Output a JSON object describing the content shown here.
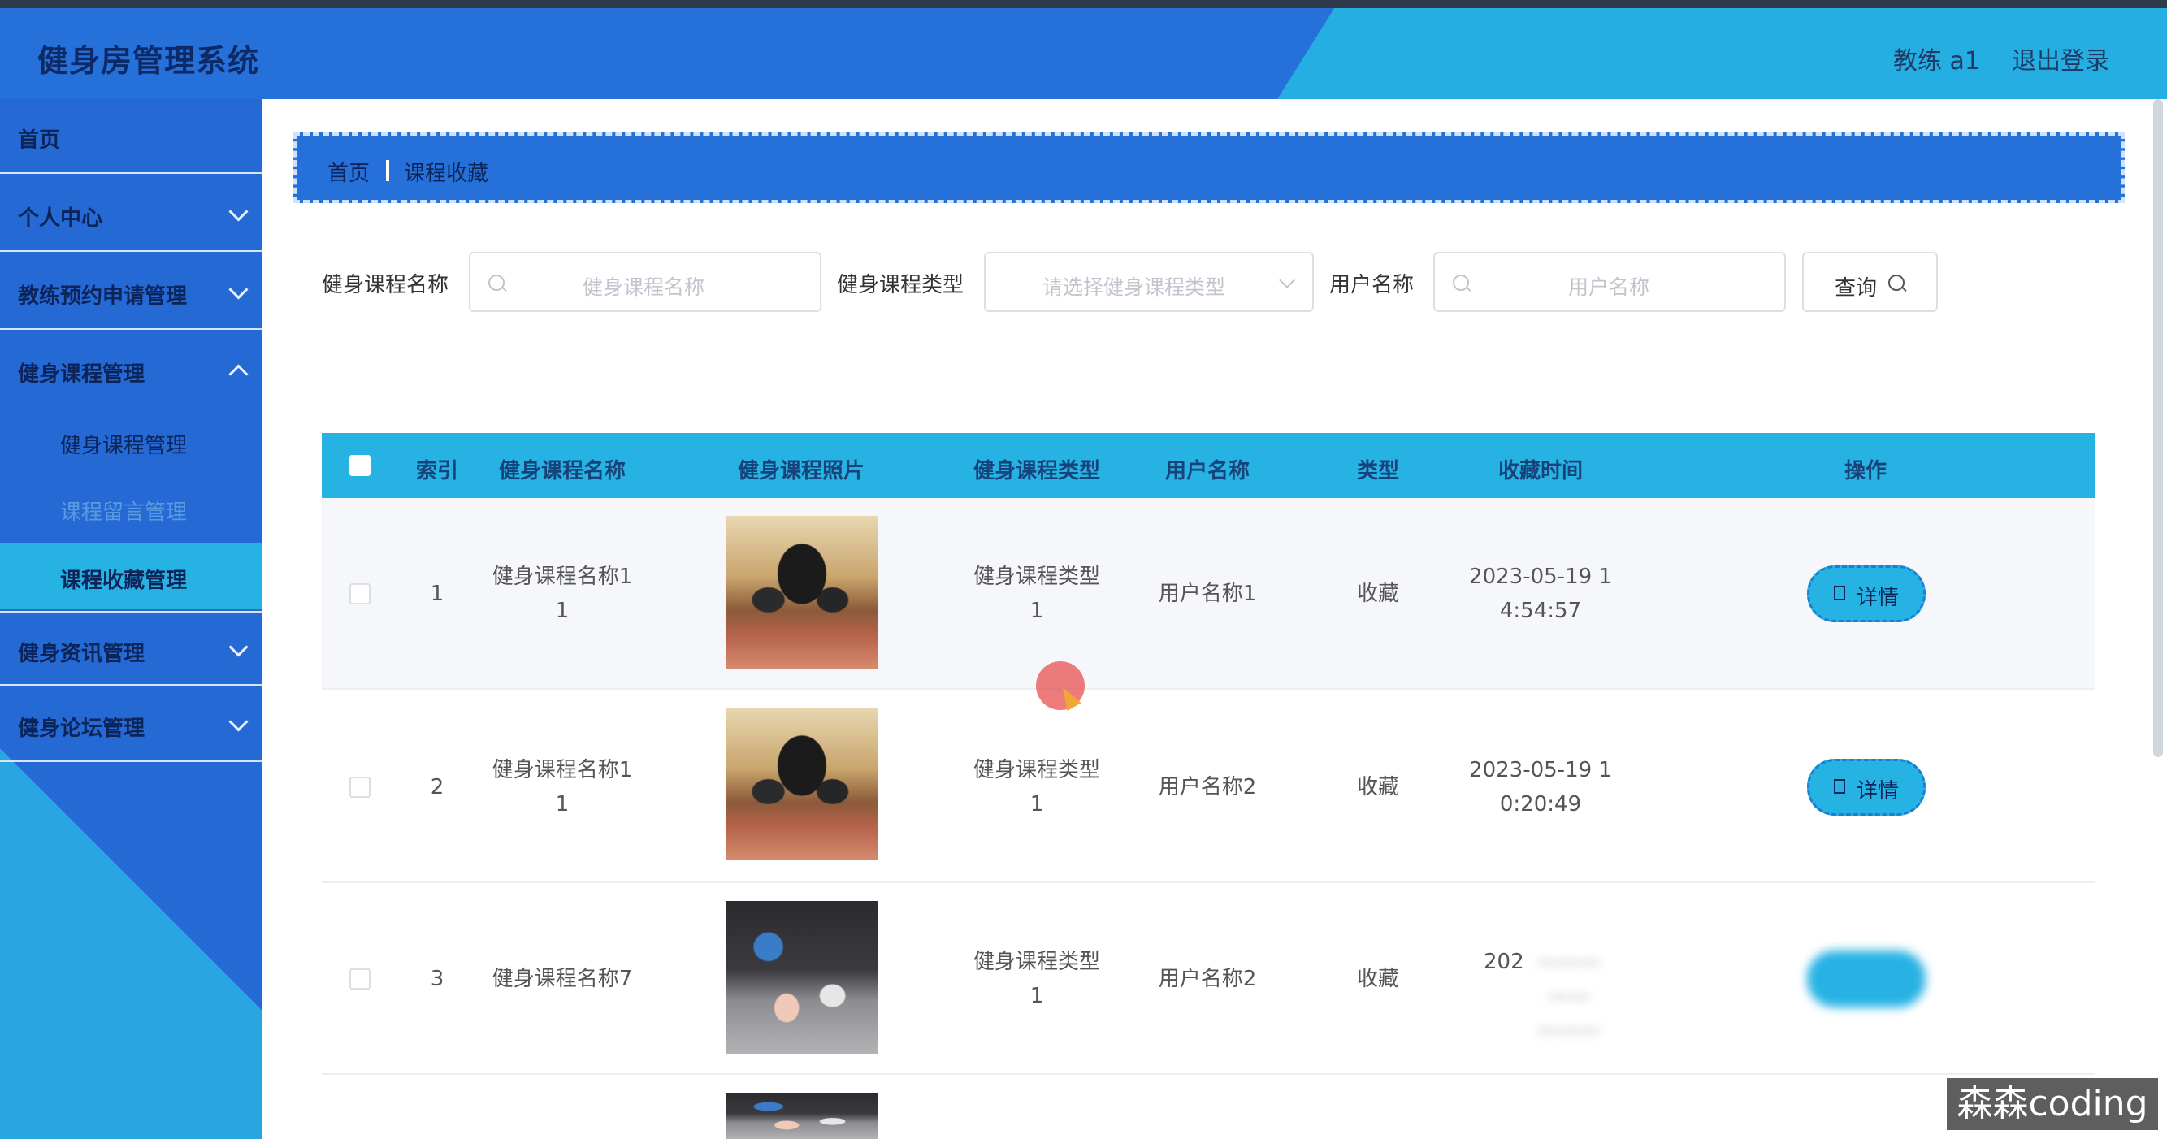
{
  "header": {
    "app_title": "健身房管理系统",
    "user_label": "教练 a1",
    "logout_label": "退出登录"
  },
  "sidebar": {
    "items": [
      {
        "label": "首页"
      },
      {
        "label": "个人中心"
      },
      {
        "label": "教练预约申请管理"
      },
      {
        "label": "健身课程管理"
      },
      {
        "label": "健身资讯管理"
      },
      {
        "label": "健身论坛管理"
      }
    ],
    "sub_items": [
      {
        "label": "健身课程管理"
      },
      {
        "label": "课程留言管理"
      },
      {
        "label": "课程收藏管理"
      }
    ]
  },
  "breadcrumb": {
    "home": "首页",
    "current": "课程收藏"
  },
  "filters": {
    "course_name_label": "健身课程名称",
    "course_name_placeholder": "健身课程名称",
    "course_type_label": "健身课程类型",
    "course_type_placeholder": "请选择健身课程类型",
    "user_name_label": "用户名称",
    "user_name_placeholder": "用户名称",
    "query_label": "查询"
  },
  "table": {
    "columns": [
      "索引",
      "健身课程名称",
      "健身课程照片",
      "健身课程类型",
      "用户名称",
      "类型",
      "收藏时间",
      "操作"
    ],
    "rows": [
      {
        "index": "1",
        "name_line1": "健身课程名称1",
        "name_line2": "1",
        "type_line1": "健身课程类型",
        "type_line2": "1",
        "user": "用户名称1",
        "kind": "收藏",
        "time_line1": "2023-05-19 1",
        "time_line2": "4:54:57",
        "action": "详情"
      },
      {
        "index": "2",
        "name_line1": "健身课程名称1",
        "name_line2": "1",
        "type_line1": "健身课程类型",
        "type_line2": "1",
        "user": "用户名称2",
        "kind": "收藏",
        "time_line1": "2023-05-19 1",
        "time_line2": "0:20:49",
        "action": "详情"
      },
      {
        "index": "3",
        "name_line1": "健身课程名称7",
        "name_line2": "",
        "type_line1": "健身课程类型",
        "type_line2": "1",
        "user": "用户名称2",
        "kind": "收藏",
        "time_line1": "202",
        "time_line2": "",
        "action": ""
      }
    ]
  },
  "watermark": "森森coding"
}
